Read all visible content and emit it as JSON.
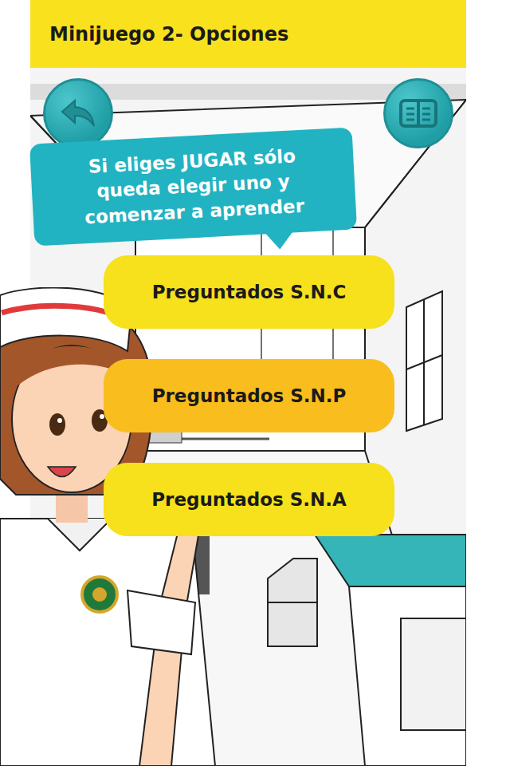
{
  "top_bar": {
    "title": "Minijuego 2- Opciones"
  },
  "speech_bubble": {
    "lines": [
      "Si eliges JUGAR sólo",
      "queda elegir uno y",
      "comenzar a aprender"
    ]
  },
  "options": [
    {
      "label": "Preguntados S.N.C",
      "color": "#f6e11c"
    },
    {
      "label": "Preguntados S.N.P",
      "color": "#f9be1d"
    },
    {
      "label": "Preguntados S.N.A",
      "color": "#f6e11c"
    }
  ]
}
